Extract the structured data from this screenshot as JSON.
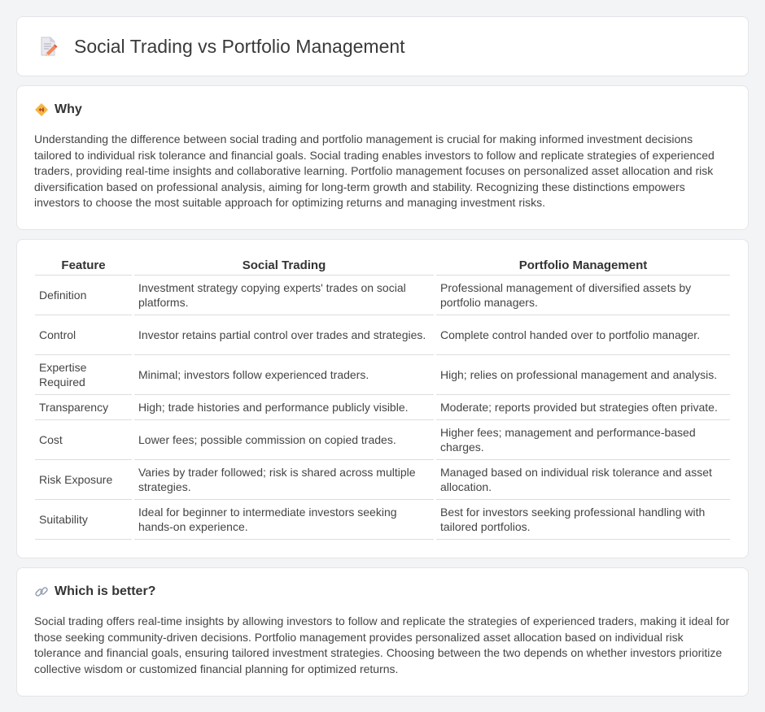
{
  "header": {
    "title": "Social Trading vs Portfolio Management",
    "icon": "document-pencil-icon"
  },
  "why": {
    "icon": "diamond-arrows-icon",
    "title": "Why",
    "text": "Understanding the difference between social trading and portfolio management is crucial for making informed investment decisions tailored to individual risk tolerance and financial goals. Social trading enables investors to follow and replicate strategies of experienced traders, providing real-time insights and collaborative learning. Portfolio management focuses on personalized asset allocation and risk diversification based on professional analysis, aiming for long-term growth and stability. Recognizing these distinctions empowers investors to choose the most suitable approach for optimizing returns and managing investment risks."
  },
  "comparison": {
    "headers": [
      "Feature",
      "Social Trading",
      "Portfolio Management"
    ],
    "rows": [
      [
        "Definition",
        "Investment strategy copying experts' trades on social platforms.",
        "Professional management of diversified assets by portfolio managers."
      ],
      [
        "Control",
        "Investor retains partial control over trades and strategies.",
        "Complete control handed over to portfolio manager."
      ],
      [
        "Expertise Required",
        "Minimal; investors follow experienced traders.",
        "High; relies on professional management and analysis."
      ],
      [
        "Transparency",
        "High; trade histories and performance publicly visible.",
        "Moderate; reports provided but strategies often private."
      ],
      [
        "Cost",
        "Lower fees; possible commission on copied trades.",
        "Higher fees; management and performance-based charges."
      ],
      [
        "Risk Exposure",
        "Varies by trader followed; risk is shared across multiple strategies.",
        "Managed based on individual risk tolerance and asset allocation."
      ],
      [
        "Suitability",
        "Ideal for beginner to intermediate investors seeking hands-on experience.",
        "Best for investors seeking professional handling with tailored portfolios."
      ]
    ]
  },
  "better": {
    "icon": "link-icon",
    "title": "Which is better?",
    "text": "Social trading offers real-time insights by allowing investors to follow and replicate the strategies of experienced traders, making it ideal for those seeking community-driven decisions. Portfolio management provides personalized asset allocation based on individual risk tolerance and financial goals, ensuring tailored investment strategies. Choosing between the two depends on whether investors prioritize collective wisdom or customized financial planning for optimized returns."
  }
}
